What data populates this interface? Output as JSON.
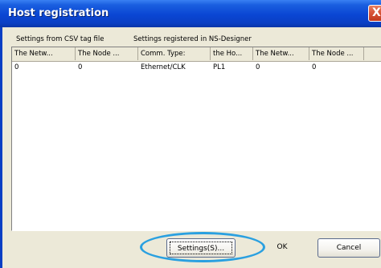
{
  "window": {
    "title": "Host registration",
    "close_glyph": "X"
  },
  "sections": {
    "csv_label": "Settings from CSV tag file",
    "designer_label": "Settings registered in NS-Designer"
  },
  "table": {
    "columns": [
      "The Netw...",
      "The Node ...",
      "Comm. Type:",
      "the Ho...",
      "The Netw...",
      "The Node ..."
    ],
    "rows": [
      [
        "0",
        "0",
        "Ethernet/CLK",
        "PL1",
        "0",
        "0"
      ]
    ]
  },
  "buttons": {
    "settings": "Settings(S)...",
    "ok": "OK",
    "cancel": "Cancel"
  },
  "colors": {
    "titlebar": "#0a46d3",
    "highlight": "#2aa0e0",
    "window_bg": "#ece9d8"
  }
}
